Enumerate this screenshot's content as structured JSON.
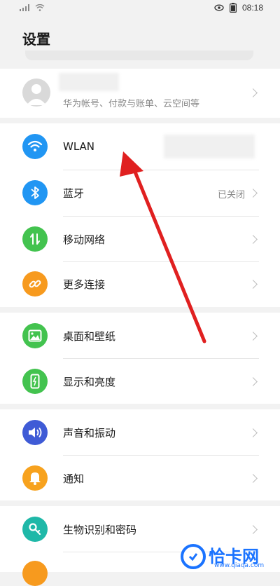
{
  "status_bar": {
    "time": "08:18"
  },
  "page": {
    "title": "设置"
  },
  "account": {
    "subtitle": "华为帐号、付款与账单、云空间等"
  },
  "sections": {
    "network": [
      {
        "label": "WLAN",
        "icon": "wifi-icon",
        "color": "#2196f3"
      },
      {
        "label": "蓝牙",
        "icon": "bluetooth-icon",
        "color": "#2196f3",
        "status": "已关闭"
      },
      {
        "label": "移动网络",
        "icon": "mobile-data-icon",
        "color": "#43c34f"
      },
      {
        "label": "更多连接",
        "icon": "link-icon",
        "color": "#f79a1e"
      }
    ],
    "display": [
      {
        "label": "桌面和壁纸",
        "icon": "wallpaper-icon",
        "color": "#43c34f"
      },
      {
        "label": "显示和亮度",
        "icon": "display-icon",
        "color": "#43c34f"
      }
    ],
    "sound": [
      {
        "label": "声音和振动",
        "icon": "sound-icon",
        "color": "#3f5bd6"
      },
      {
        "label": "通知",
        "icon": "bell-icon",
        "color": "#f7a21e"
      }
    ],
    "security": [
      {
        "label": "生物识别和密码",
        "icon": "key-icon",
        "color": "#1fb8a8"
      }
    ]
  },
  "watermark": {
    "brand": "恰卡网",
    "url": "www.qiaqa.com",
    "color": "#1a73ff"
  },
  "annotation": {
    "arrow_color": "#e02020"
  }
}
